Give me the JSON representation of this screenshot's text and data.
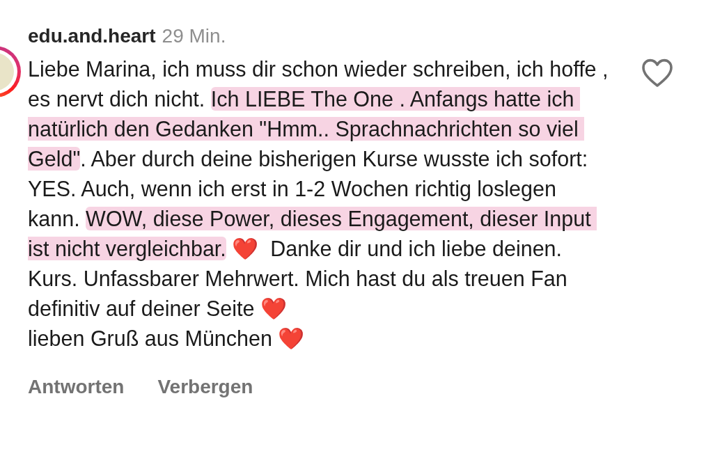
{
  "comment": {
    "username": "edu.and.heart",
    "time": "29 Min.",
    "liked": false,
    "parts": [
      {
        "text": "Liebe Marina, ich muss dir schon wieder schreiben, ich hoffe , es nervt dich nicht. ",
        "highlighted": false
      },
      {
        "text": "Ich LIEBE The One . Anfangs hatte ich natürlich den Gedanken \"Hmm.. Sprachnachrichten so viel Geld\"",
        "highlighted": true
      },
      {
        "text": ". Aber durch deine bisherigen Kurse wusste ich sofort: YES. Auch, wenn ich erst in 1-2 Wochen richtig loslegen kann. ",
        "highlighted": false
      },
      {
        "text": "WOW, diese Power, dieses Engagement, dieser Input ist nicht vergleichbar.",
        "highlighted": true
      },
      {
        "text": " ❤️  Danke dir und ich liebe deinen. Kurs. Unfassbarer Mehrwert. Mich hast du als treuen Fan definitiv auf deiner Seite ❤️\nlieben Gruß aus München ❤️",
        "highlighted": false
      }
    ],
    "actions": [
      "Antworten",
      "Verbergen"
    ]
  }
}
